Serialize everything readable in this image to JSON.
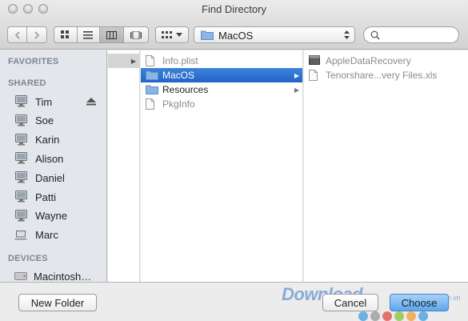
{
  "window": {
    "title": "Find Directory"
  },
  "toolbar": {
    "path_label": "MacOS",
    "search_placeholder": ""
  },
  "sidebar": {
    "favorites_header": "FAVORITES",
    "shared_header": "SHARED",
    "shared_items": [
      "Tim",
      "Soe",
      "Karin",
      "Alison",
      "Daniel",
      "Patti",
      "Wayne",
      "Marc"
    ],
    "devices_header": "DEVICES",
    "devices_items": [
      "Macintosh…"
    ]
  },
  "columns": {
    "col2": [
      {
        "label": "Info.plist",
        "dim": true,
        "icon": "document-icon",
        "folder": false,
        "selected": false
      },
      {
        "label": "MacOS",
        "dim": false,
        "icon": "folder-icon",
        "folder": true,
        "selected": true
      },
      {
        "label": "Resources",
        "dim": false,
        "icon": "folder-icon",
        "folder": true,
        "selected": false
      },
      {
        "label": "PkgInfo",
        "dim": true,
        "icon": "document-icon",
        "folder": false,
        "selected": false
      }
    ],
    "col3": [
      {
        "label": "AppleDataRecovery",
        "dim": true,
        "icon": "executable-icon"
      },
      {
        "label": "Tenorshare...very Files.xls",
        "dim": true,
        "icon": "document-icon"
      }
    ]
  },
  "buttons": {
    "new_folder": "New Folder",
    "cancel": "Cancel",
    "choose": "Choose"
  },
  "watermark": {
    "text": "Download",
    "suffix": ".com.vn"
  },
  "colors": {
    "selection": "#2f72d2",
    "sidebar_bg": "#e3e7ec",
    "primary_button": "#5ba7ee"
  }
}
